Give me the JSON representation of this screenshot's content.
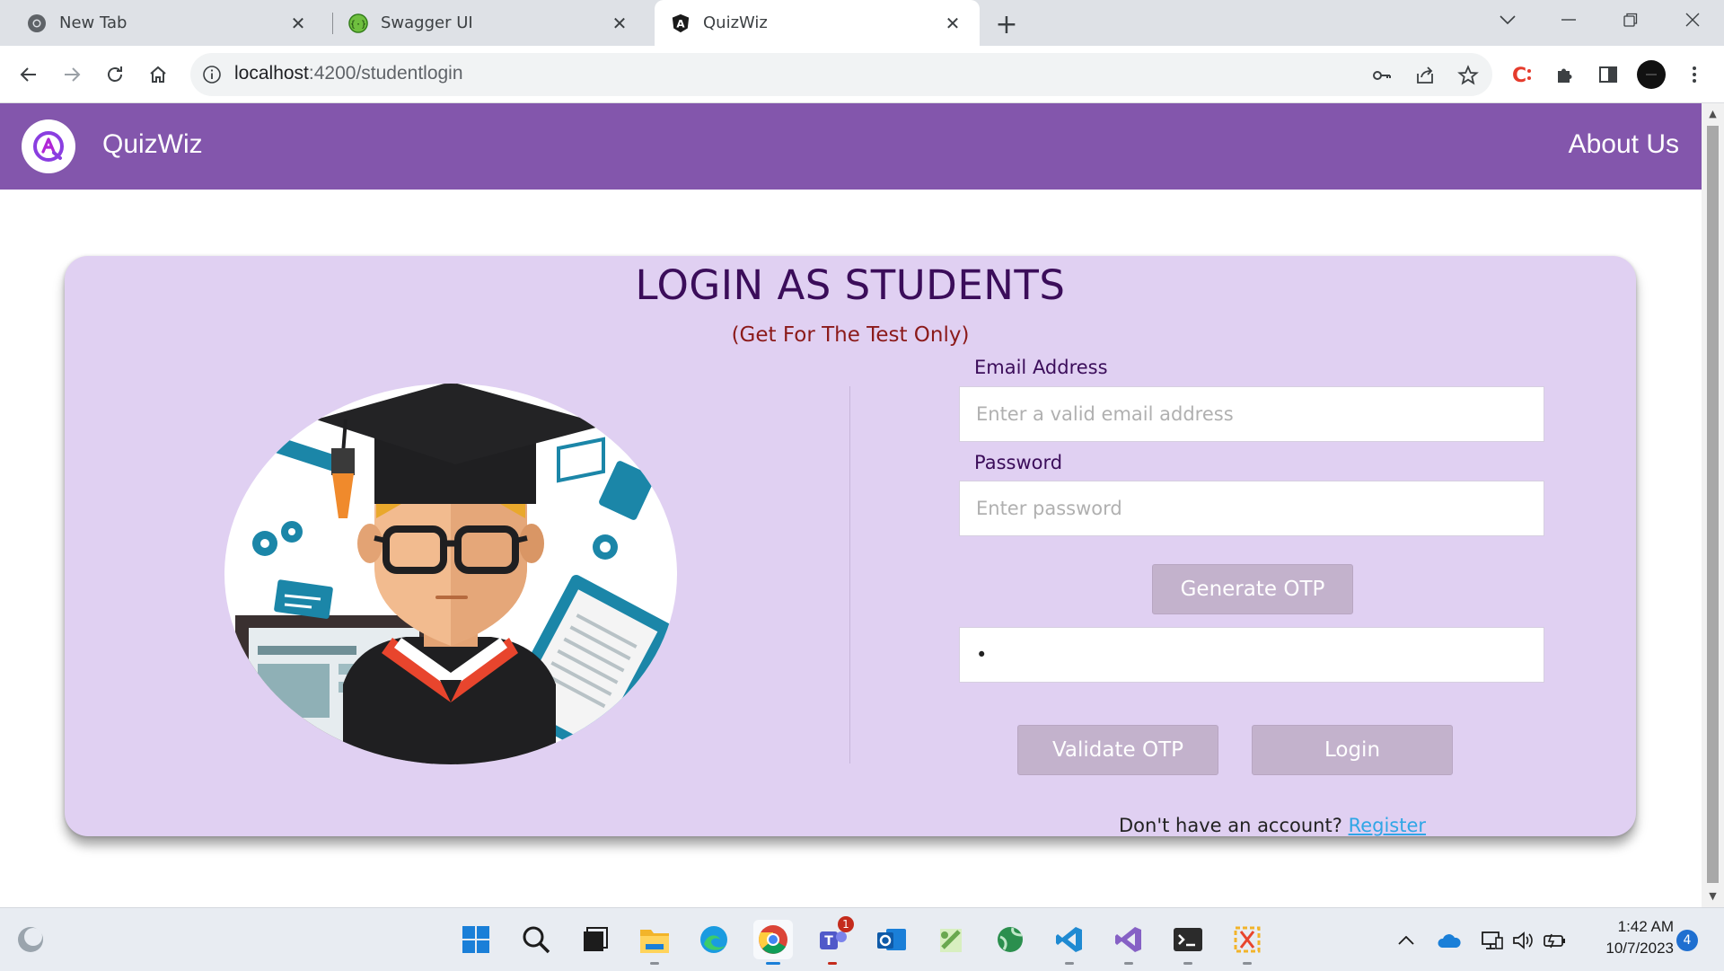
{
  "browser": {
    "tabs": [
      {
        "title": "New Tab",
        "icon": "chrome-icon",
        "active": false
      },
      {
        "title": "Swagger UI",
        "icon": "swagger-icon",
        "active": false
      },
      {
        "title": "QuizWiz",
        "icon": "angular-icon",
        "active": true
      }
    ],
    "url_host": "localhost",
    "url_path": ":4200/studentlogin"
  },
  "navbar": {
    "brand": "QuizWiz",
    "about": "About Us",
    "color": "#8356ac"
  },
  "login": {
    "title": "LOGIN AS STUDENTS",
    "subtitle": "(Get For The Test Only)",
    "email_label": "Email Address",
    "email_placeholder": "Enter a valid email address",
    "password_label": "Password",
    "password_placeholder": "Enter password",
    "generate_otp": "Generate OTP",
    "otp_value": "•",
    "validate_otp": "Validate OTP",
    "login": "Login",
    "no_account": "Don't have an account?",
    "register": "Register",
    "card_color": "#e0d0f2"
  },
  "taskbar": {
    "time": "1:42 AM",
    "date": "10/7/2023",
    "notifications": "4",
    "teams_badge": "1"
  }
}
